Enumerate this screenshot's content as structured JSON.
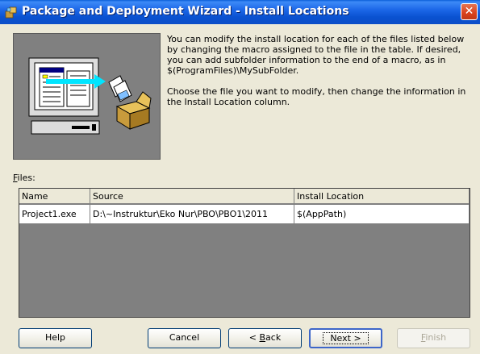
{
  "window": {
    "title": "Package and Deployment Wizard - Install Locations",
    "close_symbol": "✕"
  },
  "description": {
    "paragraph1": "You can modify the install location for each of the files listed below by changing the macro assigned to the file in the table. If desired, you can add subfolder information to the end of a macro, as in $(ProgramFiles)\\MySubFolder.",
    "paragraph2": "Choose the file you want to modify, then change the information in the Install Location column."
  },
  "files": {
    "label_accel": "F",
    "label_rest": "iles:",
    "columns": [
      "Name",
      "Source",
      "Install Location"
    ],
    "rows": [
      [
        "Project1.exe",
        "D:\\~Instruktur\\Eko Nur\\PBO\\PBO1\\2011",
        "$(AppPath)"
      ]
    ]
  },
  "buttons": {
    "help": "Help",
    "cancel": "Cancel",
    "back_accel": "B",
    "back_prefix": "< ",
    "back_rest": "ack",
    "next": "Next >",
    "finish_accel": "F",
    "finish_rest": "inish"
  },
  "icons": {
    "app": "package-icon",
    "illustration": "computer-to-package-illustration"
  }
}
